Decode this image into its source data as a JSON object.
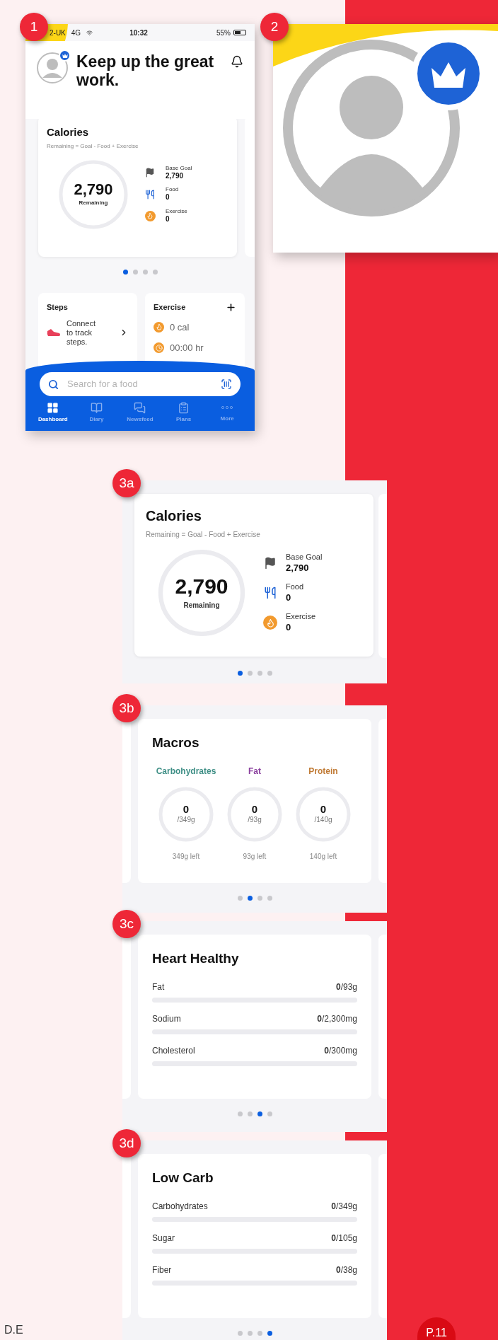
{
  "phone": {
    "badge": "1",
    "status_bar": {
      "carrier": "2-UK",
      "network": "4G",
      "time": "10:32",
      "battery": "55%"
    },
    "greeting": "Keep up the great work.",
    "calories": {
      "title": "Calories",
      "formula": "Remaining = Goal - Food + Exercise",
      "remaining": "2,790",
      "remaining_label": "Remaining",
      "stats": [
        {
          "kind": "flag",
          "label": "Base Goal",
          "value": "2,790"
        },
        {
          "kind": "food",
          "label": "Food",
          "value": "0"
        },
        {
          "kind": "fire",
          "label": "Exercise",
          "value": "0"
        }
      ]
    },
    "dots": [
      {
        "selected": true
      },
      {
        "selected": false
      },
      {
        "selected": false
      },
      {
        "selected": false
      }
    ],
    "steps": {
      "title": "Steps",
      "text": "Connect to track steps."
    },
    "exercise": {
      "title": "Exercise",
      "items": [
        {
          "kind": "fire",
          "text": "0 cal"
        },
        {
          "kind": "clock",
          "text": "00:00 hr"
        }
      ]
    },
    "search": {
      "placeholder": "Search for a food"
    },
    "nav": [
      {
        "kind": "dashboard",
        "label": "Dashboard",
        "selected": true
      },
      {
        "kind": "diary",
        "label": "Diary",
        "selected": false
      },
      {
        "kind": "newsfeed",
        "label": "Newsfeed",
        "selected": false
      },
      {
        "kind": "plans",
        "label": "Plans",
        "selected": false
      },
      {
        "kind": "more",
        "label": "More",
        "selected": false
      }
    ]
  },
  "closeup": {
    "badge": "2"
  },
  "carousel": [
    {
      "badge": "3a",
      "kind": "calories",
      "card": {
        "title": "Calories",
        "formula": "Remaining = Goal - Food + Exercise",
        "remaining": "2,790",
        "remaining_label": "Remaining",
        "stats": [
          {
            "kind": "flag",
            "label": "Base Goal",
            "value": "2,790"
          },
          {
            "kind": "food",
            "label": "Food",
            "value": "0"
          },
          {
            "kind": "fire",
            "label": "Exercise",
            "value": "0"
          }
        ]
      },
      "dots": [
        {
          "selected": true
        },
        {
          "selected": false
        },
        {
          "selected": false
        },
        {
          "selected": false
        }
      ]
    },
    {
      "badge": "3b",
      "kind": "macros",
      "card": {
        "title": "Macros",
        "macros": [
          {
            "name": "Carbohydrates",
            "color": "#3f8f86",
            "value": "0",
            "goal": "/349g",
            "left": "349g left"
          },
          {
            "name": "Fat",
            "color": "#8a3f9e",
            "value": "0",
            "goal": "/93g",
            "left": "93g left"
          },
          {
            "name": "Protein",
            "color": "#c07a34",
            "value": "0",
            "goal": "/140g",
            "left": "140g left"
          }
        ]
      },
      "dots": [
        {
          "selected": false
        },
        {
          "selected": true
        },
        {
          "selected": false
        },
        {
          "selected": false
        }
      ]
    },
    {
      "badge": "3c",
      "kind": "nutrients",
      "card": {
        "title": "Heart Healthy",
        "rows": [
          {
            "name": "Fat",
            "amount": "**0**/93g",
            "level": 0
          },
          {
            "name": "Sodium",
            "amount": "**0**/2,300mg",
            "level": 0
          },
          {
            "name": "Cholesterol",
            "amount": "**0**/300mg",
            "level": 0
          }
        ]
      },
      "dots": [
        {
          "selected": false
        },
        {
          "selected": false
        },
        {
          "selected": true
        },
        {
          "selected": false
        }
      ]
    },
    {
      "badge": "3d",
      "kind": "nutrients",
      "card": {
        "title": "Low Carb",
        "rows": [
          {
            "name": "Carbohydrates",
            "amount": "**0**/349g",
            "level": 0
          },
          {
            "name": "Sugar",
            "amount": "**0**/105g",
            "level": 0
          },
          {
            "name": "Fiber",
            "amount": "**0**/38g",
            "level": 0
          }
        ]
      },
      "dots": [
        {
          "selected": false
        },
        {
          "selected": false
        },
        {
          "selected": false
        },
        {
          "selected": true
        }
      ]
    }
  ],
  "footer": {
    "author": "D.E",
    "page": "P.11"
  }
}
